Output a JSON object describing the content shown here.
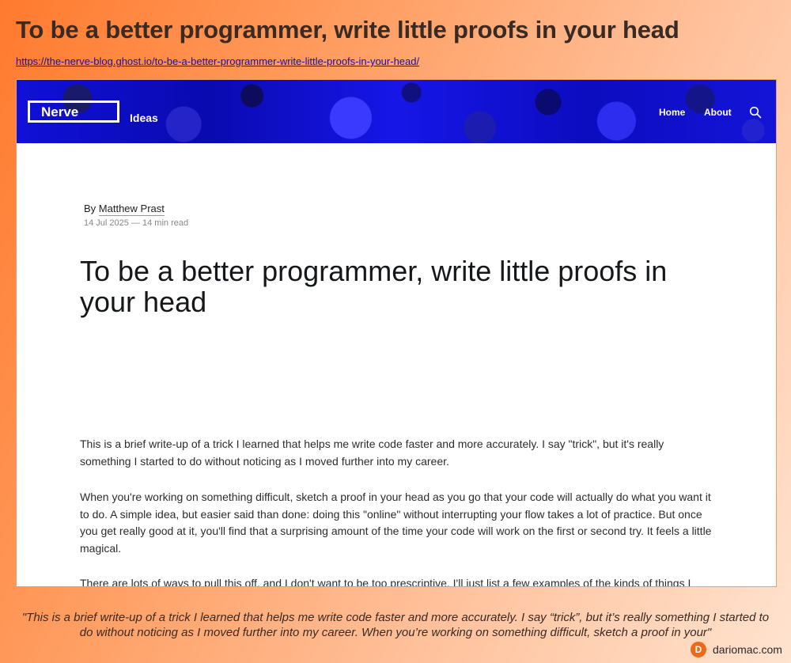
{
  "heading": "To be a better programmer, write little proofs in your head",
  "source_url": "https://the-nerve-blog.ghost.io/to-be-a-better-programmer-write-little-proofs-in-your-head/",
  "site": {
    "logo": "Nerve",
    "logo_subtitle": "Ideas",
    "nav": [
      "Home",
      "About"
    ],
    "search_icon": "search-icon"
  },
  "article": {
    "byline_prefix": "By",
    "author": "Matthew Prast",
    "meta": "14 Jul 2025 — 14 min read",
    "title": "To be a better programmer, write little proofs in your head",
    "paragraphs": [
      "This is a brief write-up of a trick I learned that helps me write code faster and more accurately. I say \"trick\", but it's really something I started to do without noticing as I moved further into my career.",
      "When you're working on something difficult, sketch a proof in your head as you go that your code will actually do what you want it to do. A simple idea, but easier said than done: doing this \"online\" without interrupting your flow takes a lot of practice. But once you get really good at it, you'll find that a surprising amount of the time your code will work on the first or second try. It feels a little magical.",
      "There are lots of ways to pull this off, and I don't want to be too prescriptive. I'll just list a few examples of the kinds of things I"
    ]
  },
  "quote": "\"This is a brief write-up of a trick I learned that helps me write code faster and more accurately. I say “trick”, but it’s really something I started to do without noticing as I moved further into my career. When you’re working on something difficult, sketch a proof in your\"",
  "credit": {
    "logo_letter": "D",
    "text": "dariomac.com"
  },
  "colors": {
    "header_blue": "#1414d8",
    "credit_orange": "#ea6a1a",
    "link": "#1a0dab"
  }
}
